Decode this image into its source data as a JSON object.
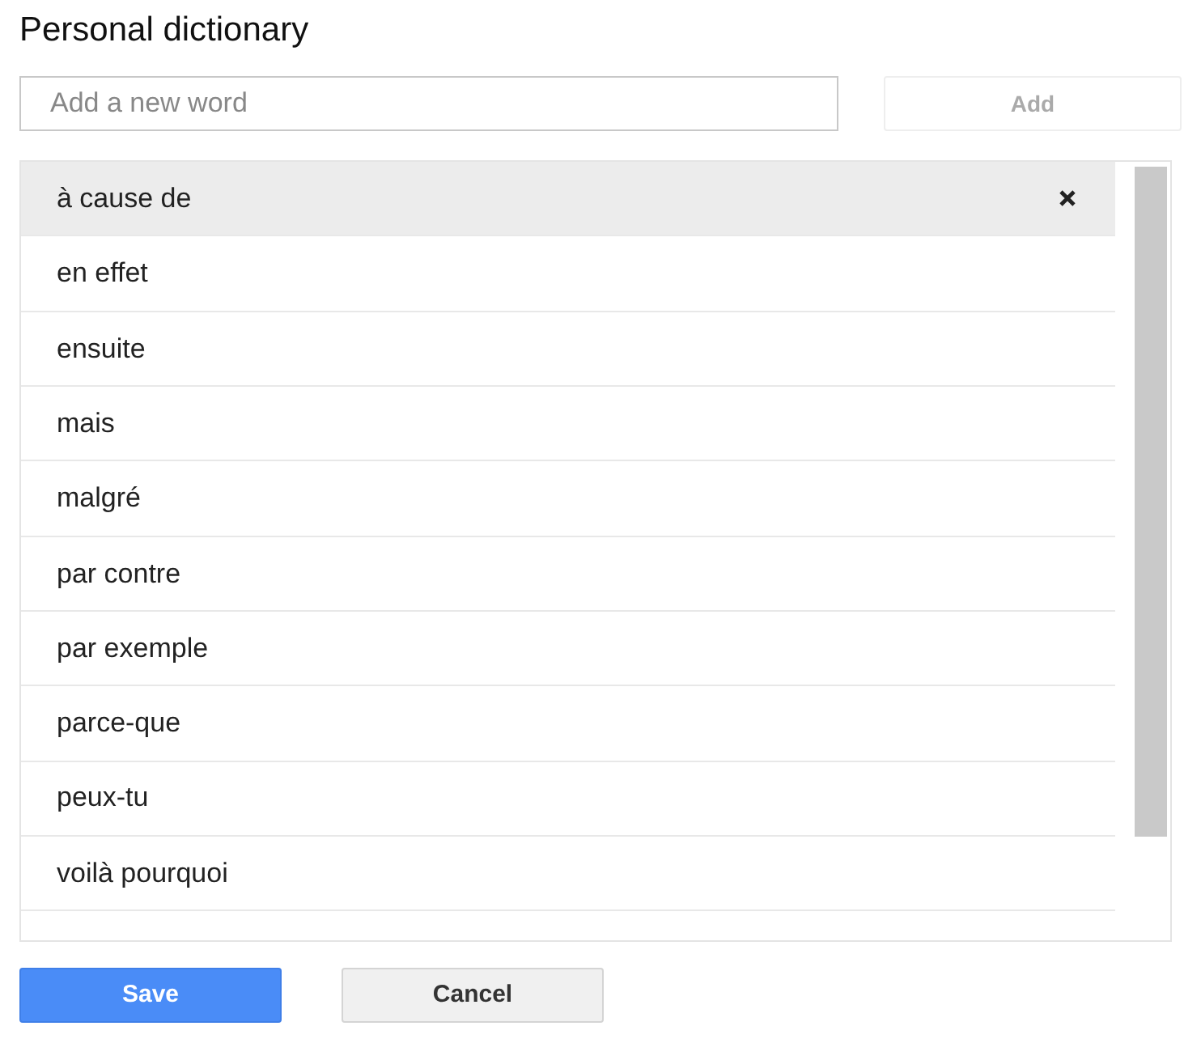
{
  "title": "Personal dictionary",
  "new_word": {
    "placeholder": "Add a new word"
  },
  "add_button": {
    "label": "Add",
    "disabled": true
  },
  "words": [
    {
      "text": "à cause de",
      "selected": true
    },
    {
      "text": "en effet",
      "selected": false
    },
    {
      "text": "ensuite",
      "selected": false
    },
    {
      "text": "mais",
      "selected": false
    },
    {
      "text": "malgré",
      "selected": false
    },
    {
      "text": "par contre",
      "selected": false
    },
    {
      "text": "par exemple",
      "selected": false
    },
    {
      "text": "parce-que",
      "selected": false
    },
    {
      "text": "peux-tu",
      "selected": false
    },
    {
      "text": "voilà pourquoi",
      "selected": false
    }
  ],
  "buttons": [
    {
      "label": "Save",
      "kind": "primary"
    },
    {
      "label": "Cancel",
      "kind": "secondary"
    }
  ]
}
